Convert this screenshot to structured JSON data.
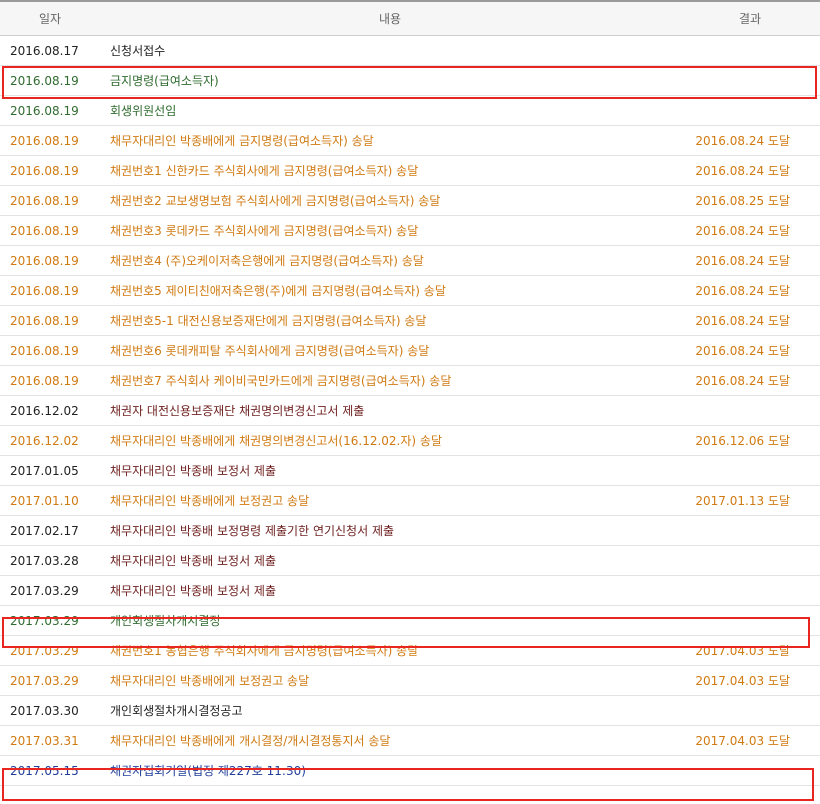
{
  "header": {
    "date": "일자",
    "content": "내용",
    "result": "결과"
  },
  "colors": {
    "black": "#222222",
    "green": "#2f6b2f",
    "orange": "#d07a12",
    "maroon": "#6e1f1f",
    "blue": "#1f3f9a",
    "highlight": "#e8261f"
  },
  "rows": [
    {
      "date": "2016.08.17",
      "content": "신청서접수",
      "result": ""
    },
    {
      "date": "2016.08.19",
      "content": "금지명령(급여소득자)",
      "result": ""
    },
    {
      "date": "2016.08.19",
      "content": "회생위원선임",
      "result": ""
    },
    {
      "date": "2016.08.19",
      "content": "채무자대리인 박종배에게 금지명령(급여소득자) 송달",
      "result": "2016.08.24 도달"
    },
    {
      "date": "2016.08.19",
      "content": "채권번호1 신한카드 주식회사에게 금지명령(급여소득자) 송달",
      "result": "2016.08.24 도달"
    },
    {
      "date": "2016.08.19",
      "content": "채권번호2 교보생명보험 주식회사에게 금지명령(급여소득자) 송달",
      "result": "2016.08.25 도달"
    },
    {
      "date": "2016.08.19",
      "content": "채권번호3 롯데카드 주식회사에게 금지명령(급여소득자) 송달",
      "result": "2016.08.24 도달"
    },
    {
      "date": "2016.08.19",
      "content": "채권번호4 (주)오케이저축은행에게 금지명령(급여소득자) 송달",
      "result": "2016.08.24 도달"
    },
    {
      "date": "2016.08.19",
      "content": "채권번호5 제이티친애저축은행(주)에게 금지명령(급여소득자) 송달",
      "result": "2016.08.24 도달"
    },
    {
      "date": "2016.08.19",
      "content": "채권번호5-1 대전신용보증재단에게 금지명령(급여소득자) 송달",
      "result": "2016.08.24 도달"
    },
    {
      "date": "2016.08.19",
      "content": "채권번호6 롯데캐피탈 주식회사에게 금지명령(급여소득자) 송달",
      "result": "2016.08.24 도달"
    },
    {
      "date": "2016.08.19",
      "content": "채권번호7 주식회사 케이비국민카드에게 금지명령(급여소득자) 송달",
      "result": "2016.08.24 도달"
    },
    {
      "date": "2016.12.02",
      "content": "채권자 대전신용보증재단 채권명의변경신고서 제출",
      "result": ""
    },
    {
      "date": "2016.12.02",
      "content": "채무자대리인 박종배에게 채권명의변경신고서(16.12.02.자) 송달",
      "result": "2016.12.06 도달"
    },
    {
      "date": "2017.01.05",
      "content": "채무자대리인 박종배 보정서 제출",
      "result": ""
    },
    {
      "date": "2017.01.10",
      "content": "채무자대리인 박종배에게 보정권고 송달",
      "result": "2017.01.13 도달"
    },
    {
      "date": "2017.02.17",
      "content": "채무자대리인 박종배 보정명령 제출기한 연기신청서 제출",
      "result": ""
    },
    {
      "date": "2017.03.28",
      "content": "채무자대리인 박종배 보정서 제출",
      "result": ""
    },
    {
      "date": "2017.03.29",
      "content": "채무자대리인 박종배 보정서 제출",
      "result": ""
    },
    {
      "date": "2017.03.29",
      "content": "개인회생절차개시결정",
      "result": ""
    },
    {
      "date": "2017.03.29",
      "content": "채권번호1 농협은행 주식회사에게 금지명령(급여소득자) 송달",
      "result": "2017.04.03 도달"
    },
    {
      "date": "2017.03.29",
      "content": "채무자대리인 박종배에게 보정권고 송달",
      "result": "2017.04.03 도달"
    },
    {
      "date": "2017.03.30",
      "content": "개인회생절차개시결정공고",
      "result": ""
    },
    {
      "date": "2017.03.31",
      "content": "채무자대리인 박종배에게 개시결정/개시결정통지서 송달",
      "result": "2017.04.03 도달"
    },
    {
      "date": "2017.05.15",
      "content": "채권자집회기일(법정 제227호 11:30)",
      "result": ""
    }
  ]
}
